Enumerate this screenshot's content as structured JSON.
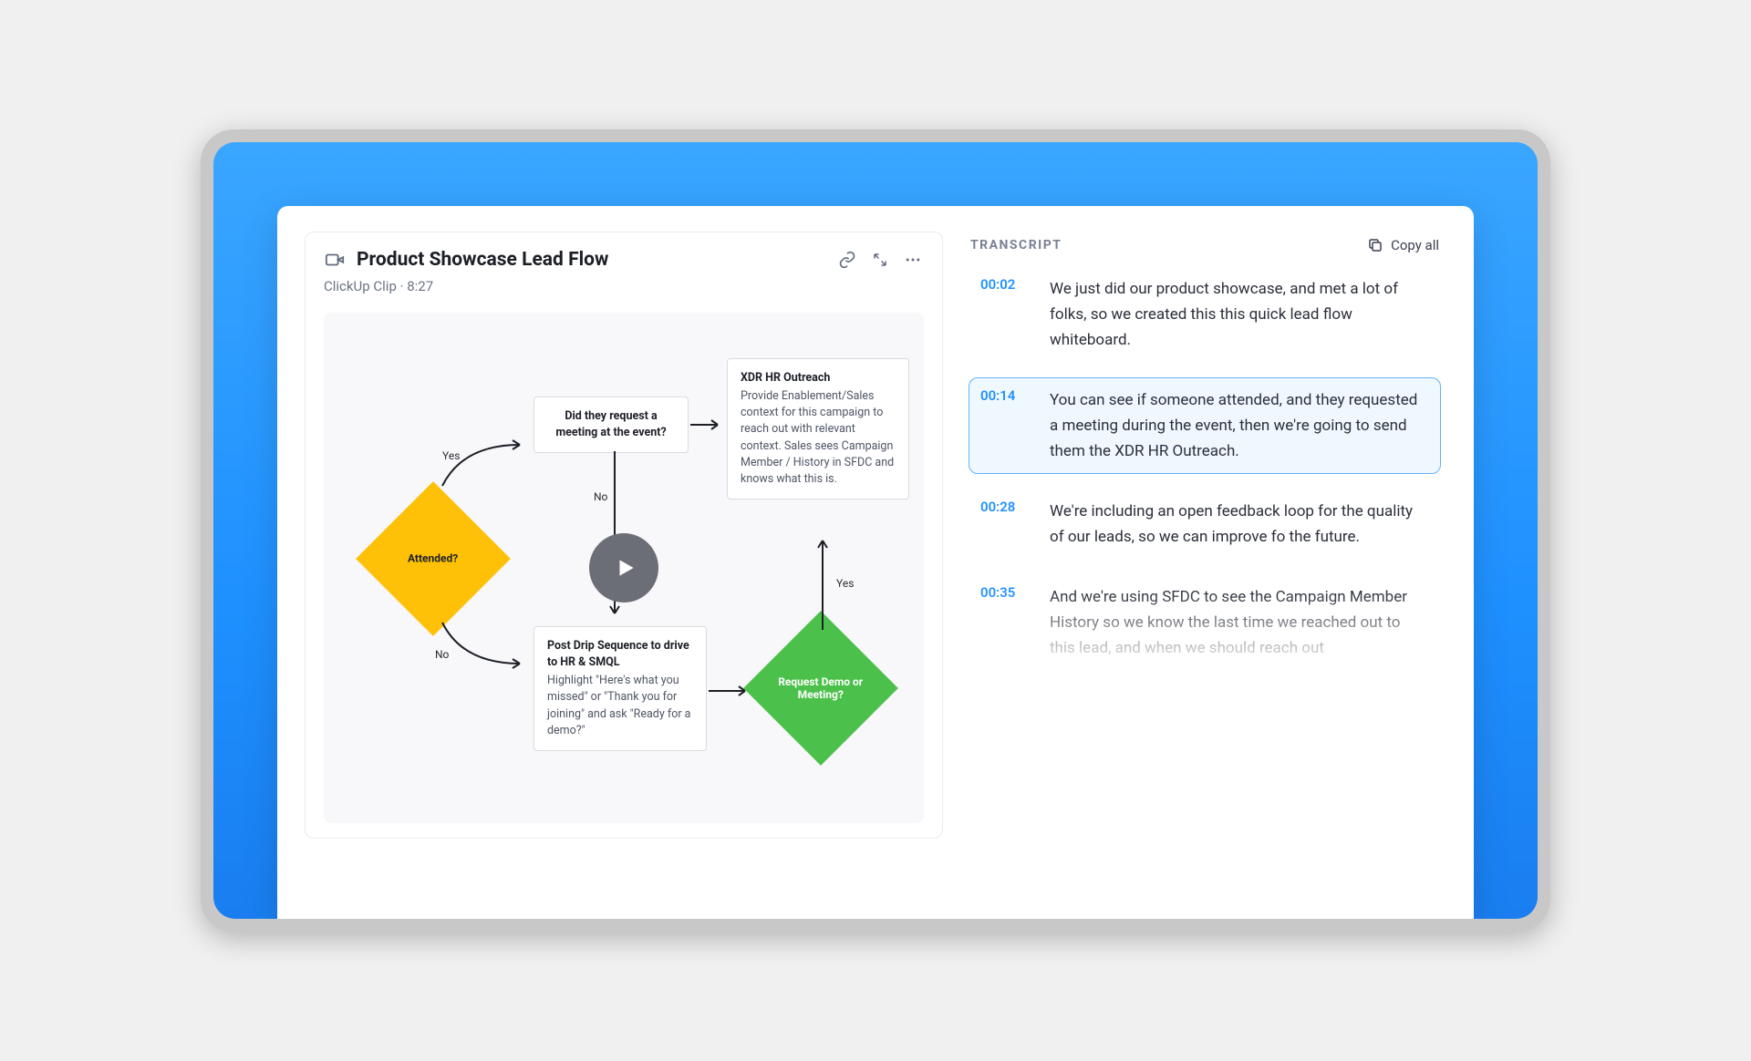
{
  "clip": {
    "title": "Product Showcase Lead Flow",
    "source": "ClickUp Clip",
    "duration": "8:27",
    "subtitle": "ClickUp Clip  ·  8:27"
  },
  "flow": {
    "attended_label": "Attended?",
    "attended_yes": "Yes",
    "attended_no": "No",
    "request_meeting_title": "Did they request a meeting at the event?",
    "request_meeting_no": "No",
    "xdr_title": "XDR HR Outreach",
    "xdr_desc": "Provide Enablement/Sales context for this campaign to reach out with relevant context. Sales sees Campaign Member / History in SFDC and knows what this is.",
    "drip_title": "Post Drip Sequence to drive to HR & SMQL",
    "drip_desc": "Highlight \"Here's what you missed\" or \"Thank you for joining\" and ask \"Ready for a demo?\"",
    "demo_label": "Request Demo or Meeting?",
    "demo_yes": "Yes"
  },
  "transcript": {
    "heading": "TRANSCRIPT",
    "copy_all_label": "Copy all",
    "items": [
      {
        "time": "00:02",
        "text": "We just did our product showcase, and met a lot of folks, so we created this this quick lead flow whiteboard."
      },
      {
        "time": "00:14",
        "text": "You can see if someone attended, and they requested a meeting during the event, then we're going to send them the XDR HR Outreach."
      },
      {
        "time": "00:28",
        "text": "We're including an open feedback loop for the quality of our leads, so we can improve fo the future."
      },
      {
        "time": "00:35",
        "text": "And we're using SFDC to see the Campaign Member History so we know the last time we reached out to this lead, and when we should reach out"
      }
    ],
    "active_index": 1
  }
}
